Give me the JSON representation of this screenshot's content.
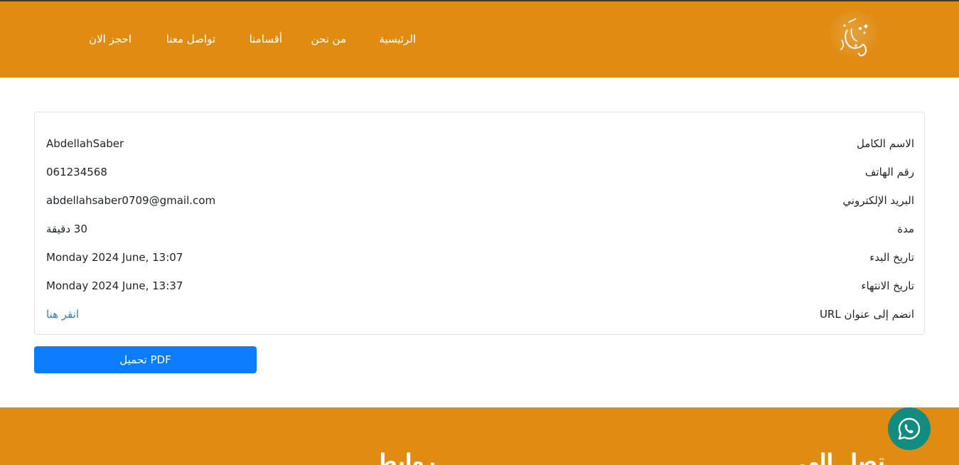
{
  "header": {
    "nav": [
      {
        "label": "الرئيسية"
      },
      {
        "label": "من نحن"
      },
      {
        "label": "أقسامنا"
      },
      {
        "label": "تواصل معنا"
      },
      {
        "label": "احجز الان"
      }
    ],
    "logo_icon": "calligraphy-logo"
  },
  "booking": {
    "rows": [
      {
        "label": "الاسم الكامل",
        "value": "AbdellahSaber"
      },
      {
        "label": "رقم الهاتف",
        "value": "061234568"
      },
      {
        "label": "البريد الإلكتروني",
        "value": "abdellahsaber0709@gmail.com"
      },
      {
        "label": "مدة",
        "value": "30 دقيقة"
      },
      {
        "label": "تاريخ البدء",
        "value": "Monday 2024 June, 13:07"
      },
      {
        "label": "تاريخ الانتهاء",
        "value": "Monday 2024 June, 13:37"
      },
      {
        "label": "انضم إلى عنوان URL",
        "value": "انقر هنا"
      }
    ]
  },
  "actions": {
    "download_pdf": "تحميل PDF"
  },
  "footer": {
    "heading_contact": "تصل الي",
    "heading_links": "روابط"
  },
  "colors": {
    "brand_orange": "#e08c12",
    "button_blue": "#0a7cff",
    "link_blue": "#2d7fc6",
    "whatsapp_green": "#128c7e"
  },
  "icons": {
    "whatsapp": "whatsapp-icon"
  }
}
